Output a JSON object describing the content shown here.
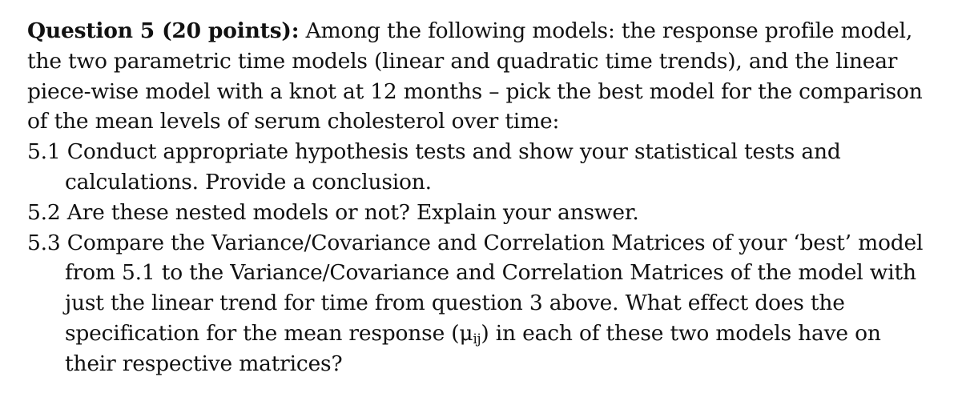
{
  "question": {
    "heading": "Question 5 (20 points):",
    "intro_lines": [
      " Among the following models: the response profile model,",
      "the two parametric time models (linear and quadratic time trends), and the linear",
      "piece-wise model with a knot at 12 months – pick the best model for the comparison",
      "of the mean levels of serum cholesterol over time:"
    ]
  },
  "items": [
    {
      "lines": [
        "5.1 Conduct appropriate hypothesis tests and show your statistical tests and",
        "calculations. Provide a conclusion."
      ]
    },
    {
      "lines": [
        "5.2  Are these nested models or not? Explain your answer."
      ]
    },
    {
      "lines": [
        "5.3 Compare the Variance/Covariance and Correlation Matrices of your ‘best’ model",
        "from 5.1 to the Variance/Covariance and Correlation Matrices of the model with",
        "just the linear trend for time from question 3 above. What effect does the",
        "specification for the mean response (",
        "μ",
        "ij",
        ") in each of these two models have on",
        "their respective matrices?"
      ]
    }
  ]
}
